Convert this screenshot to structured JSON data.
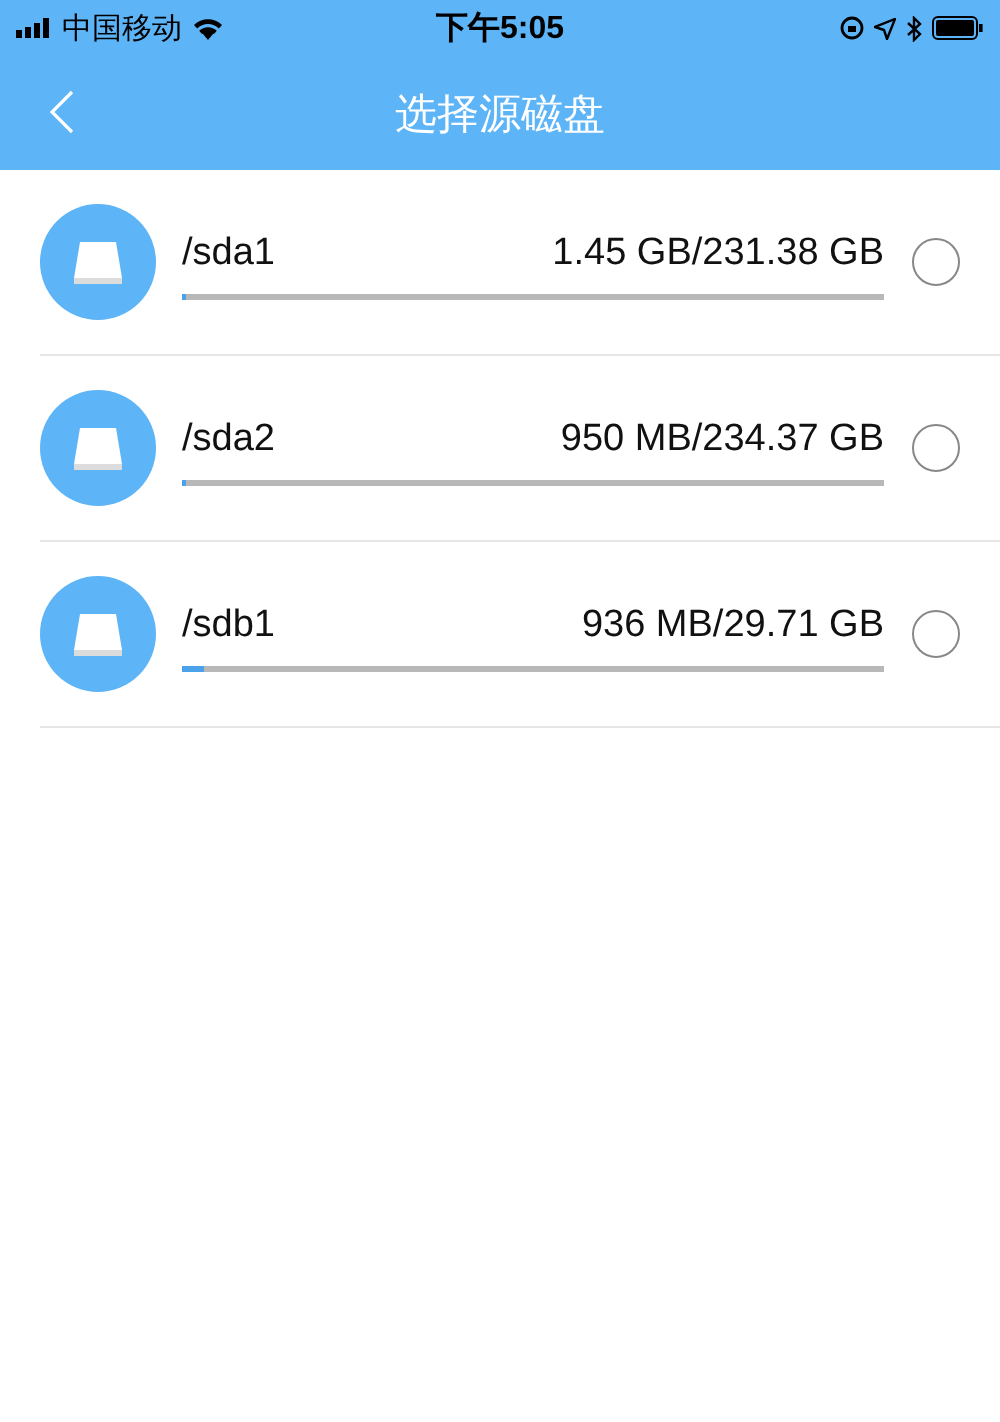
{
  "status_bar": {
    "carrier": "中国移动",
    "time": "下午5:05"
  },
  "nav": {
    "title": "选择源磁盘"
  },
  "disks": [
    {
      "name": "/sda1",
      "usage": "1.45 GB/231.38 GB",
      "level": 0.006,
      "selected": false
    },
    {
      "name": "/sda2",
      "usage": "950 MB/234.37 GB",
      "level": 0.005,
      "selected": false
    },
    {
      "name": "/sdb1",
      "usage": "936 MB/29.71 GB",
      "level": 0.03,
      "selected": false
    }
  ]
}
